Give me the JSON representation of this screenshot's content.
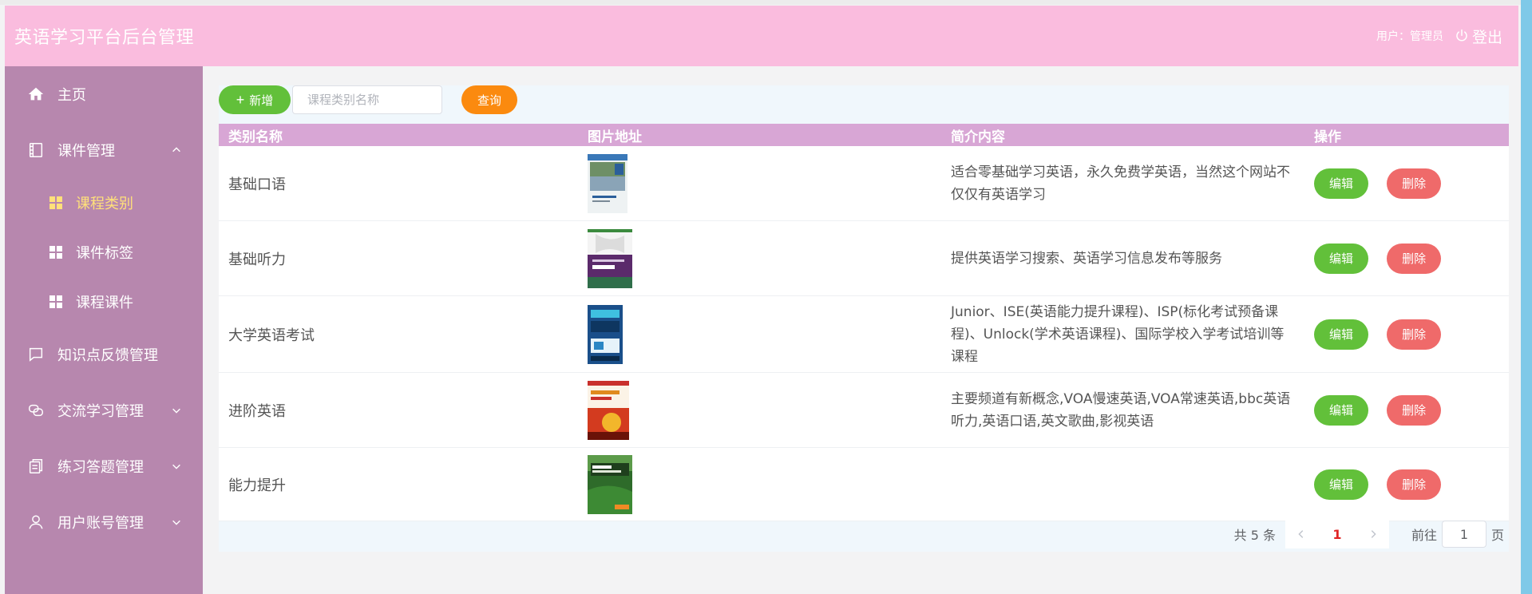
{
  "header": {
    "title": "英语学习平台后台管理",
    "user_label": "用户：管理员",
    "logout_label": "登出"
  },
  "sidebar": {
    "items": [
      {
        "label": "主页",
        "icon": "home-icon"
      },
      {
        "label": "课件管理",
        "icon": "courseware-icon",
        "expanded": true,
        "children": [
          {
            "label": "课程类别",
            "icon": "grid-icon",
            "active": true
          },
          {
            "label": "课件标签",
            "icon": "grid-icon"
          },
          {
            "label": "课程课件",
            "icon": "grid-icon"
          }
        ]
      },
      {
        "label": "知识点反馈管理",
        "icon": "chat-icon"
      },
      {
        "label": "交流学习管理",
        "icon": "exchange-icon"
      },
      {
        "label": "练习答题管理",
        "icon": "copy-icon"
      },
      {
        "label": "用户账号管理",
        "icon": "user-icon"
      }
    ]
  },
  "toolbar": {
    "add_label": "新增",
    "search_placeholder": "课程类别名称",
    "query_label": "查询"
  },
  "table": {
    "columns": [
      "类别名称",
      "图片地址",
      "简介内容",
      "操作"
    ],
    "edit_label": "编辑",
    "delete_label": "删除",
    "rows": [
      {
        "name": "基础口语",
        "desc": "适合零基础学习英语，永久免费学英语，当然这个网站不仅仅有英语学习"
      },
      {
        "name": "基础听力",
        "desc": "提供英语学习搜索、英语学习信息发布等服务"
      },
      {
        "name": "大学英语考试",
        "desc": "Junior、ISE(英语能力提升课程)、ISP(标化考试预备课程)、Unlock(学术英语课程)、国际学校入学考试培训等课程"
      },
      {
        "name": "进阶英语",
        "desc": "主要频道有新概念,VOA慢速英语,VOA常速英语,bbc英语听力,英语口语,英文歌曲,影视英语"
      },
      {
        "name": "能力提升",
        "desc": ""
      }
    ]
  },
  "pagination": {
    "total_label": "共 5 条",
    "current_page": "1",
    "goto_label": "前往",
    "page_unit": "页",
    "jump_value": "1"
  },
  "colors": {
    "header": "#fabcde",
    "sidebar": "#b787ae",
    "table_head": "#d8a6d5",
    "green": "#62c03a",
    "orange": "#fb8a0f",
    "red": "#ef6a6a",
    "active": "#ffe07a"
  }
}
